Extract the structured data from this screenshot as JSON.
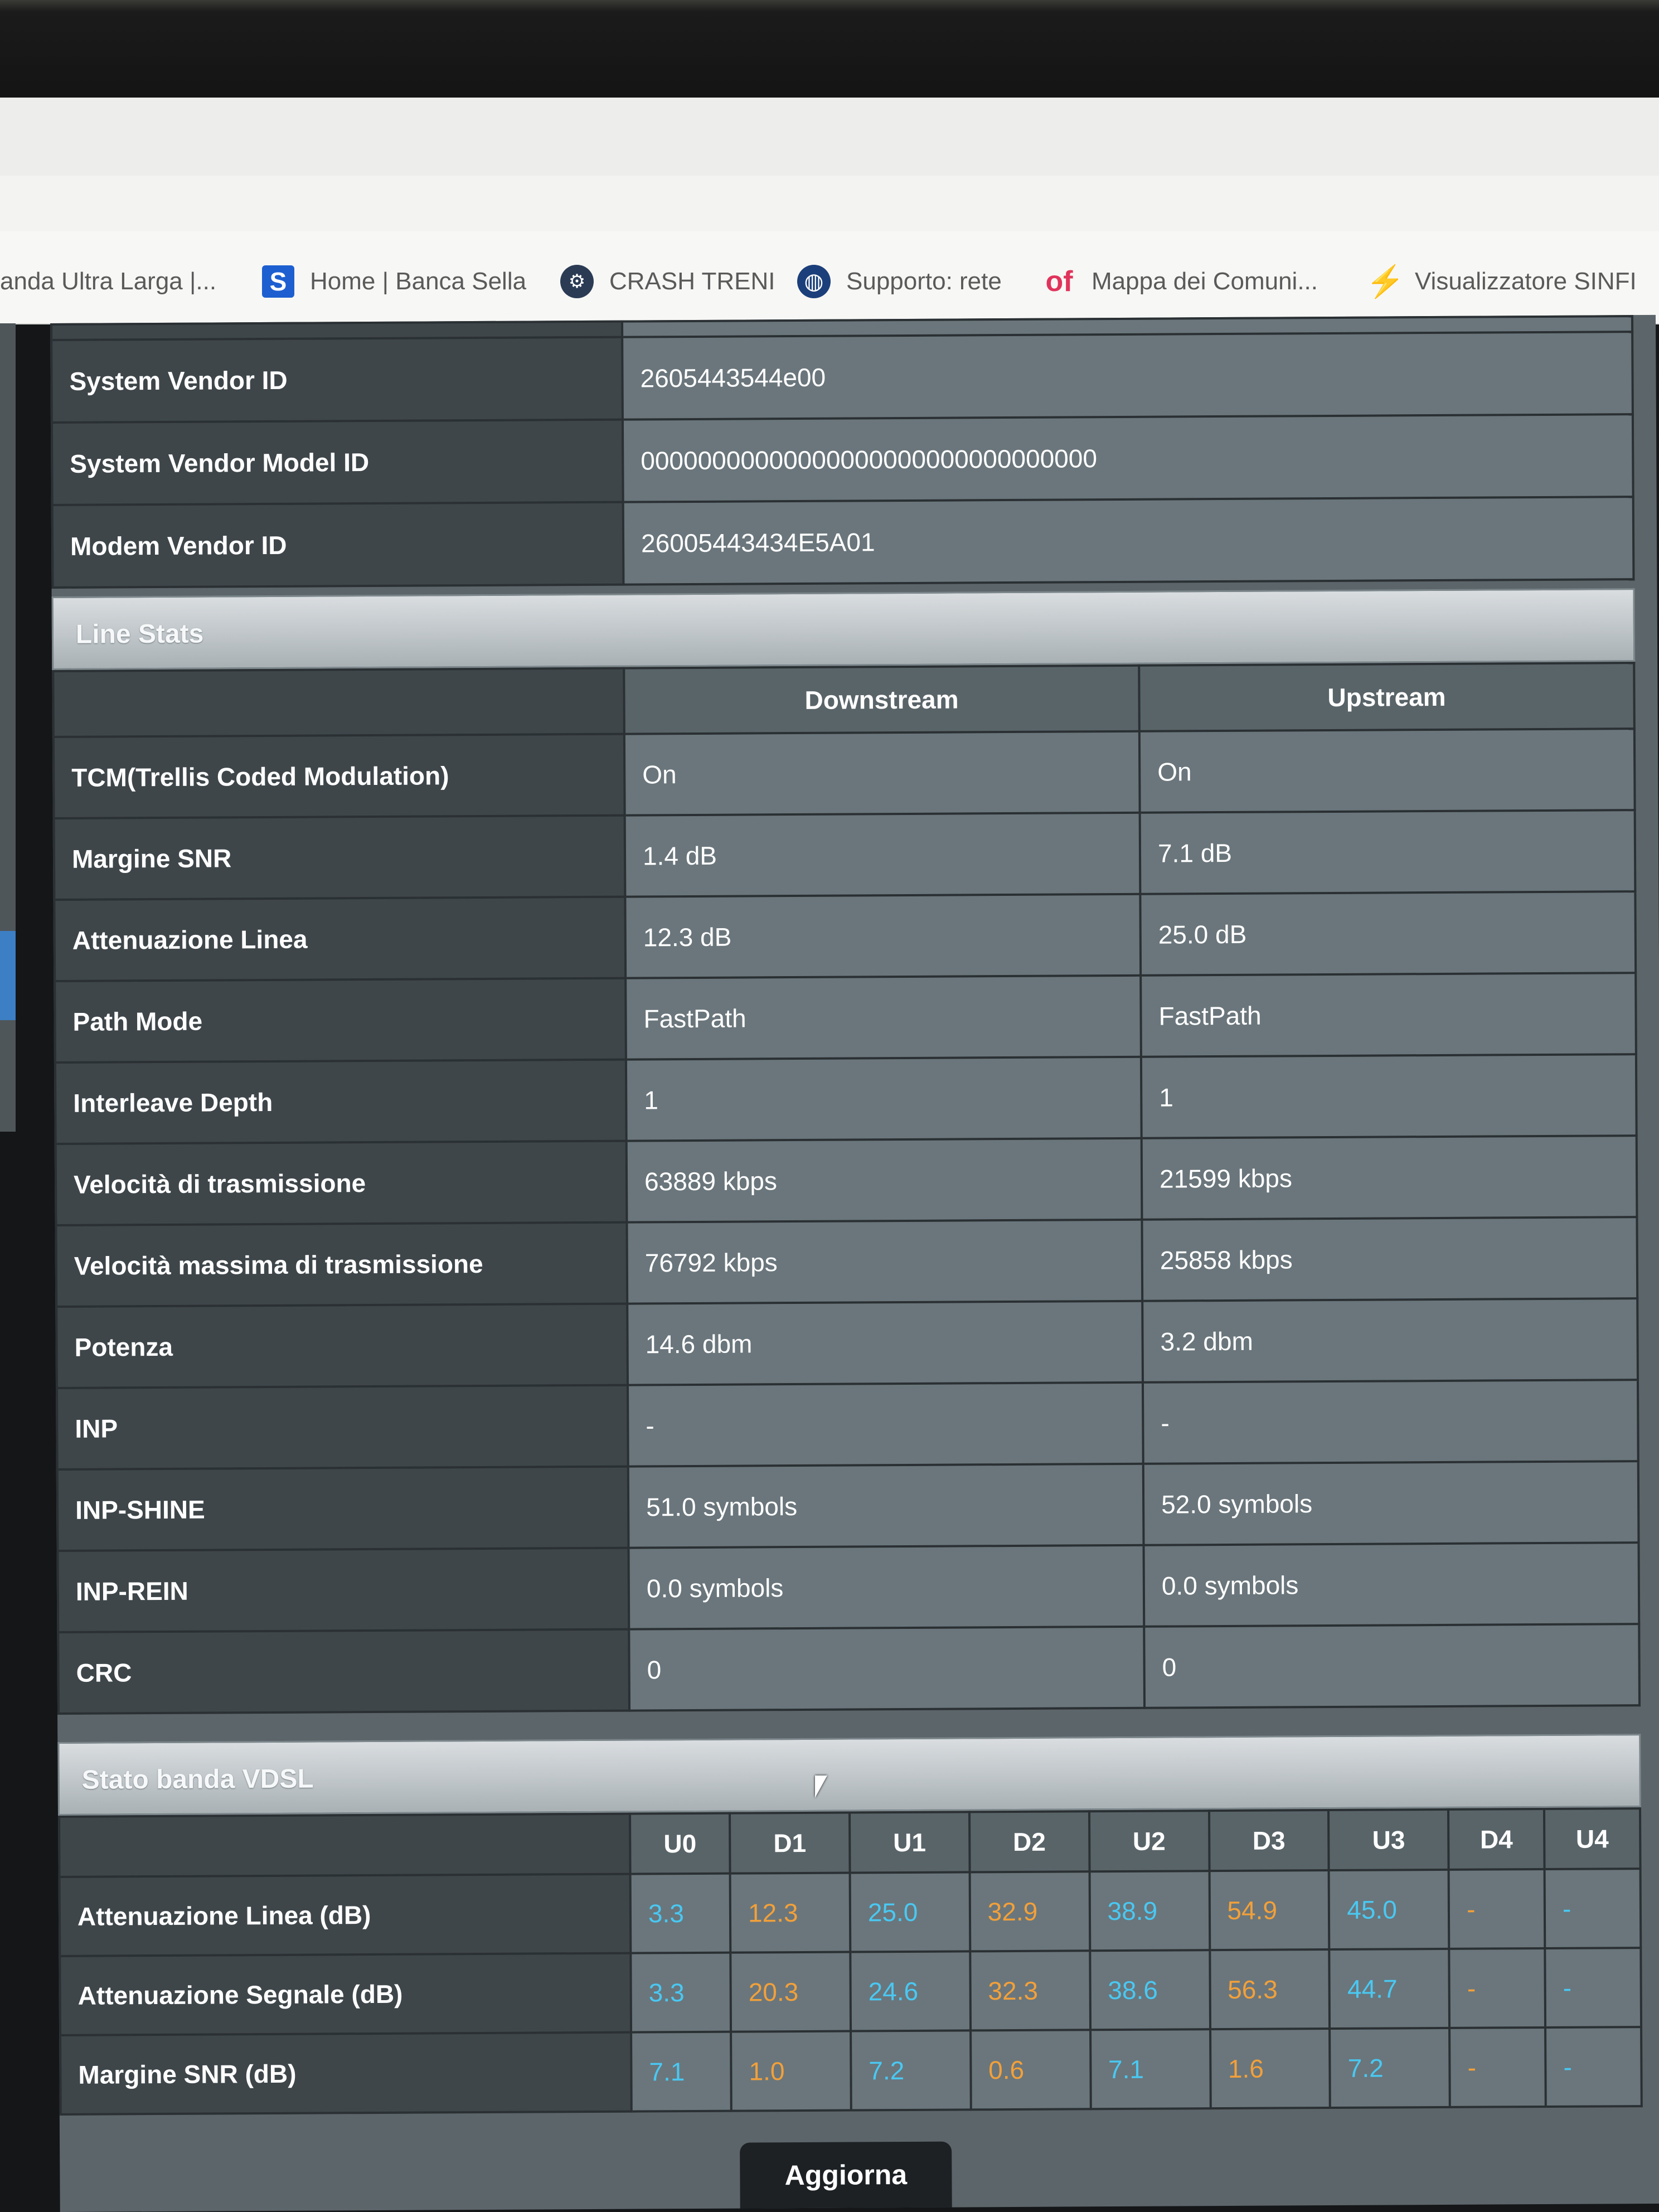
{
  "bookmarks": [
    {
      "label": "anda Ultra Larga |...",
      "icon": ""
    },
    {
      "label": "Home | Banca Sella",
      "icon": "S"
    },
    {
      "label": "CRASH TRENI",
      "icon": "steam-icon"
    },
    {
      "label": "Supporto: rete",
      "icon": "globe-icon"
    },
    {
      "label": "Mappa dei Comuni...",
      "icon": "of"
    },
    {
      "label": "Visualizzatore SINFI",
      "icon": "bolt-icon"
    }
  ],
  "vendor_info": [
    {
      "label": "System Vendor ID",
      "value": "2605443544e00"
    },
    {
      "label": "System Vendor Model ID",
      "value": "00000000000000000000000000000000"
    },
    {
      "label": "Modem Vendor ID",
      "value": "26005443434E5A01"
    }
  ],
  "line_stats": {
    "title": "Line Stats",
    "headers": [
      "Downstream",
      "Upstream"
    ],
    "rows": [
      {
        "label": "TCM(Trellis Coded Modulation)",
        "down": "On",
        "up": "On"
      },
      {
        "label": "Margine SNR",
        "down": "1.4 dB",
        "up": "7.1 dB"
      },
      {
        "label": "Attenuazione Linea",
        "down": "12.3 dB",
        "up": "25.0 dB"
      },
      {
        "label": "Path Mode",
        "down": "FastPath",
        "up": "FastPath"
      },
      {
        "label": "Interleave Depth",
        "down": "1",
        "up": "1"
      },
      {
        "label": "Velocità di trasmissione",
        "down": "63889 kbps",
        "up": "21599 kbps"
      },
      {
        "label": "Velocità massima di trasmissione",
        "down": "76792 kbps",
        "up": "25858 kbps"
      },
      {
        "label": "Potenza",
        "down": "14.6 dbm",
        "up": "3.2 dbm"
      },
      {
        "label": "INP",
        "down": "-",
        "up": "-"
      },
      {
        "label": "INP-SHINE",
        "down": "51.0 symbols",
        "up": "52.0 symbols"
      },
      {
        "label": "INP-REIN",
        "down": "0.0 symbols",
        "up": "0.0 symbols"
      },
      {
        "label": "CRC",
        "down": "0",
        "up": "0"
      }
    ]
  },
  "vdsl_band": {
    "title": "Stato banda VDSL",
    "bands": [
      "U0",
      "D1",
      "U1",
      "D2",
      "U2",
      "D3",
      "U3",
      "D4",
      "U4"
    ],
    "rows": [
      {
        "label": "Attenuazione Linea (dB)",
        "values": [
          "3.3",
          "12.3",
          "25.0",
          "32.9",
          "38.9",
          "54.9",
          "45.0",
          "-",
          "-"
        ]
      },
      {
        "label": "Attenuazione Segnale (dB)",
        "values": [
          "3.3",
          "20.3",
          "24.6",
          "32.3",
          "38.6",
          "56.3",
          "44.7",
          "-",
          "-"
        ]
      },
      {
        "label": "Margine SNR (dB)",
        "values": [
          "7.1",
          "1.0",
          "7.2",
          "0.6",
          "7.1",
          "1.6",
          "7.2",
          "-",
          "-"
        ]
      }
    ],
    "colors": {
      "upstream": "#4ac8f2",
      "downstream": "#f2a03a"
    }
  },
  "refresh_button": "Aggiorna"
}
